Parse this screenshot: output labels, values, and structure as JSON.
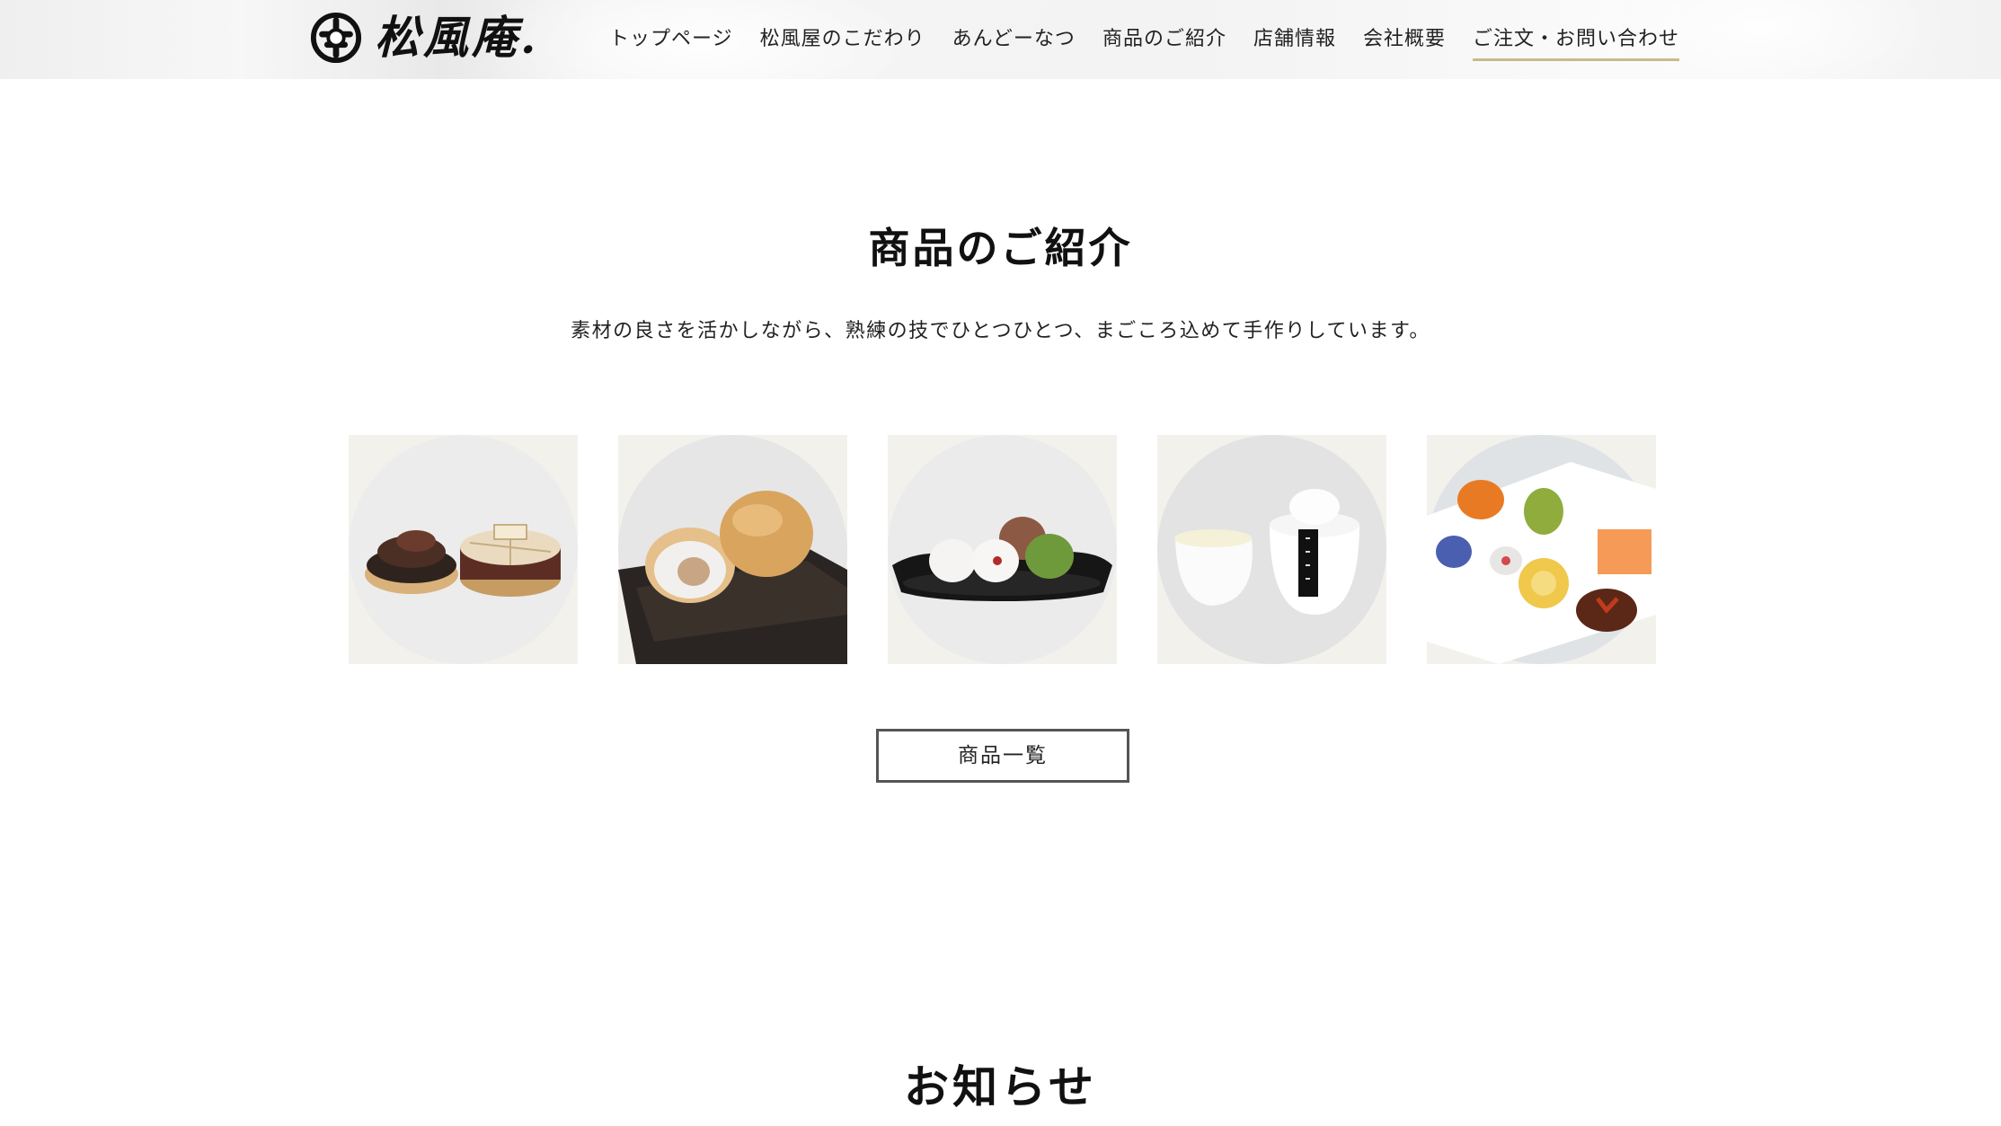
{
  "header": {
    "logo_text": "松風庵.",
    "nav": [
      {
        "label": "トップページ"
      },
      {
        "label": "松風屋のこだわり"
      },
      {
        "label": "あんどーなつ"
      },
      {
        "label": "商品のご紹介"
      },
      {
        "label": "店舗情報"
      },
      {
        "label": "会社概要"
      },
      {
        "label": "ご注文・お問い合わせ"
      }
    ],
    "active_index": 6
  },
  "products_section": {
    "title": "商品のご紹介",
    "description": "素材の良さを活かしながら、熟練の技でひとつひとつ、まごころ込めて手作りしています。",
    "button_label": "商品一覧",
    "images": [
      {
        "icon": "monaka-image"
      },
      {
        "icon": "manju-image"
      },
      {
        "icon": "daifuku-image"
      },
      {
        "icon": "pudding-image"
      },
      {
        "icon": "wagashi-image"
      }
    ]
  },
  "news_section": {
    "title": "お知らせ"
  },
  "colors": {
    "accent_underline": "#c7bb8a",
    "button_border": "#555555"
  }
}
